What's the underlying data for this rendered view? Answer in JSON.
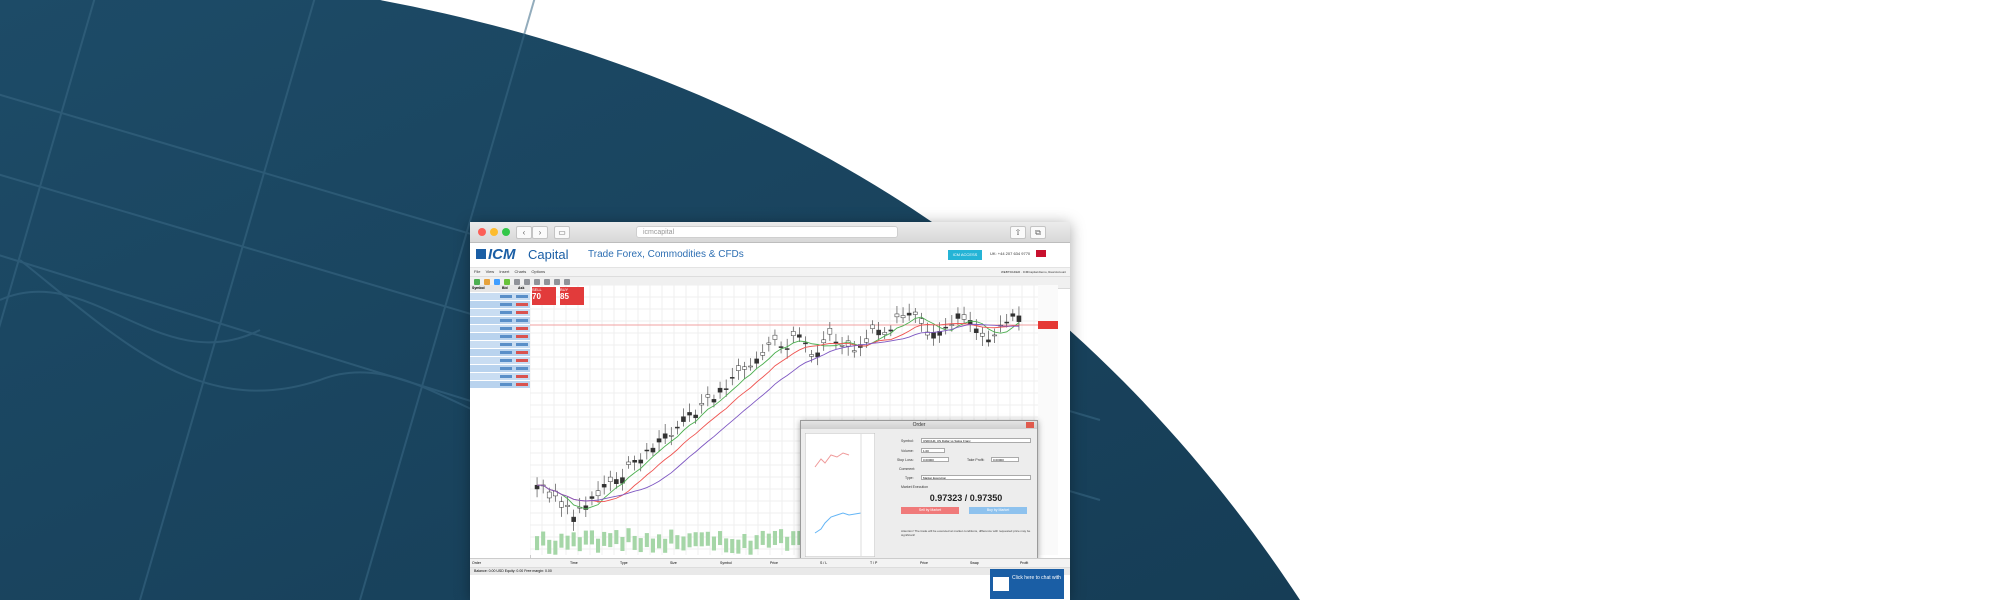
{
  "browser": {
    "url": "icmcapital",
    "nav_back": "‹",
    "nav_forward": "›"
  },
  "site": {
    "brand": "ICM",
    "brand_suffix": "Capital",
    "tagline": "Trade Forex, Commodities & CFDs",
    "account_button": "ICM ACCESS",
    "phone": "UK: +44 207 634 9770"
  },
  "platform": {
    "menu": [
      "File",
      "View",
      "Insert",
      "Charts",
      "Options"
    ],
    "server_info": "WEBTRADER · ICMCapital-Demo, Real Account"
  },
  "watchlist": {
    "headers": [
      "Symbol",
      "Bid",
      "Ask"
    ]
  },
  "trade_panel": {
    "sell_label": "SELL",
    "buy_label": "BUY",
    "sell_price": "70",
    "buy_price": "85"
  },
  "order_dialog": {
    "title": "Order",
    "symbol_label": "Symbol:",
    "symbol_value": "USDCHF, US Dollar vs Swiss Franc",
    "volume_label": "Volume:",
    "volume_value": "1.00",
    "stoploss_label": "Stop Loss:",
    "stoploss_value": "0.00000",
    "takeprofit_label": "Take Profit:",
    "takeprofit_value": "0.00000",
    "comment_label": "Comment:",
    "type_label": "Type:",
    "type_value": "Market Execution",
    "exec_label": "Market Execution",
    "quote": "0.97323 / 0.97350",
    "sell_button": "Sell by Market",
    "buy_button": "Buy by Market",
    "note": "Attention! The trade will be executed at market conditions, difference with requested price may be significant!"
  },
  "bottom": {
    "columns": [
      "Order",
      "Time",
      "Type",
      "Size",
      "Symbol",
      "Price",
      "S / L",
      "T / P",
      "Price",
      "Swap",
      "Profit"
    ],
    "balance": "Balance: 0.00 USD  Equity: 0.00  Free margin: 0.00",
    "chat_button": "Click here to chat with"
  },
  "colors": {
    "navy": "#1c4a66",
    "brand": "#1a5ea5",
    "sell": "#e23b3b",
    "buy": "#7ab8e8"
  }
}
